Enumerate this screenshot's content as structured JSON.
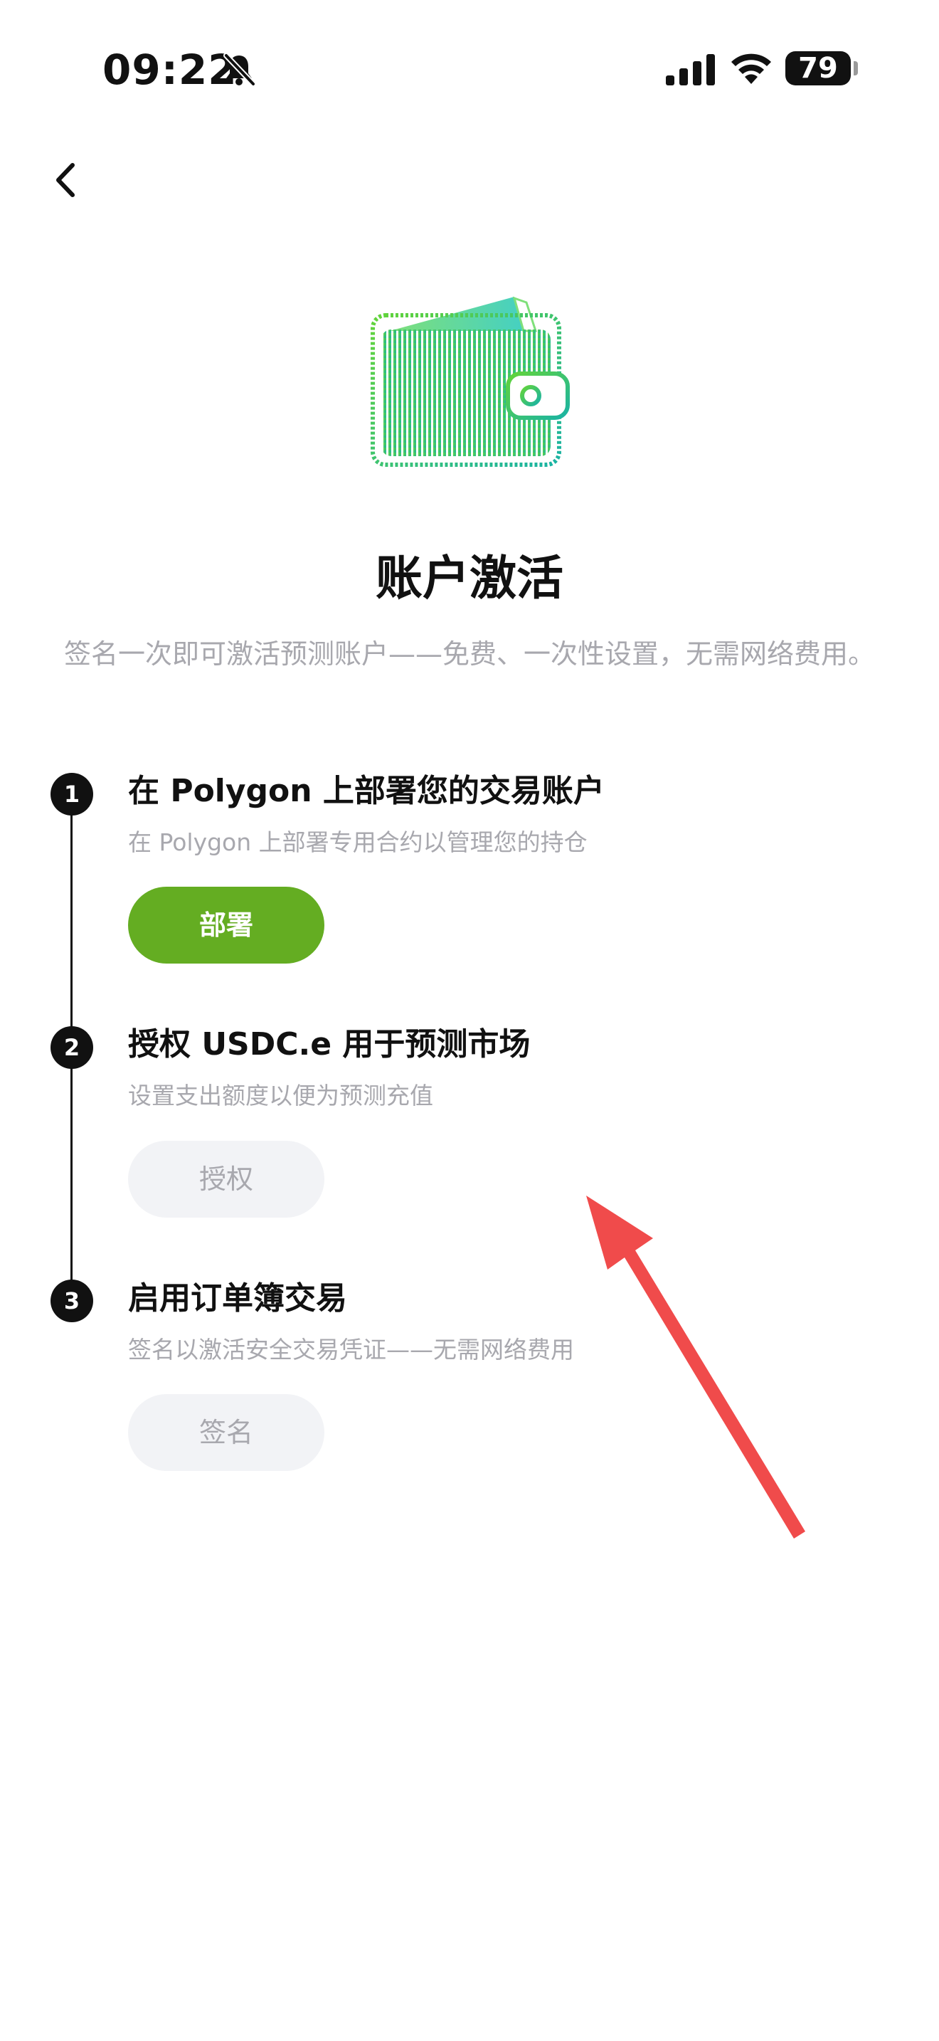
{
  "status_bar": {
    "time": "09:22",
    "battery_level": "79"
  },
  "icons": {
    "back": "chevron-left-icon",
    "bell": "bell-muted-icon",
    "signal": "cellular-signal-icon",
    "wifi": "wifi-icon",
    "wallet": "wallet-icon"
  },
  "header": {
    "title": "账户激活",
    "subtitle": "签名一次即可激活预测账户——免费、一次性设置，无需网络费用。"
  },
  "steps": [
    {
      "number": "1",
      "title": "在 Polygon 上部署您的交易账户",
      "description": "在 Polygon 上部署专用合约以管理您的持仓",
      "button_label": "部署",
      "state": "active"
    },
    {
      "number": "2",
      "title": "授权 USDC.e 用于预测市场",
      "description": "设置支出额度以便为预测充值",
      "button_label": "授权",
      "state": "disabled"
    },
    {
      "number": "3",
      "title": "启用订单簿交易",
      "description": "签名以激活安全交易凭证——无需网络费用",
      "button_label": "签名",
      "state": "disabled"
    }
  ],
  "colors": {
    "accent_green": "#64ad22",
    "disabled_bg": "#f2f3f6",
    "muted_text": "#a8a8ae",
    "annotation_arrow": "#f04b4b"
  }
}
